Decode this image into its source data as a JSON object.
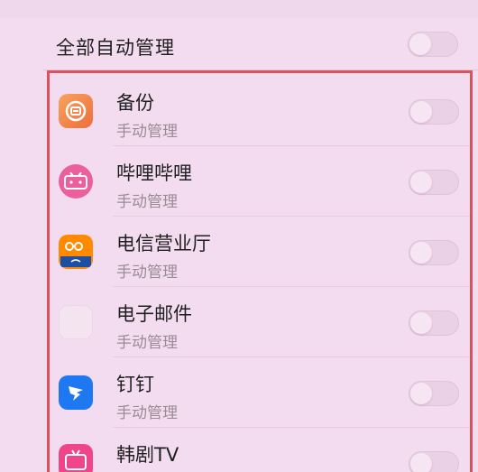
{
  "master": {
    "label": "全部自动管理",
    "enabled": false
  },
  "apps": [
    {
      "name": "备份",
      "sub": "手动管理",
      "icon": "backup-icon",
      "enabled": false
    },
    {
      "name": "哔哩哔哩",
      "sub": "手动管理",
      "icon": "bilibili-icon",
      "enabled": false
    },
    {
      "name": "电信营业厅",
      "sub": "手动管理",
      "icon": "telecom-icon",
      "enabled": false
    },
    {
      "name": "电子邮件",
      "sub": "手动管理",
      "icon": "mail-icon",
      "enabled": false
    },
    {
      "name": "钉钉",
      "sub": "手动管理",
      "icon": "dingtalk-icon",
      "enabled": false
    },
    {
      "name": "韩剧TV",
      "sub": "",
      "icon": "korean-drama-tv-icon",
      "enabled": false
    }
  ],
  "colors": {
    "highlight_border": "#d9535b",
    "background": "#f3dcef"
  }
}
